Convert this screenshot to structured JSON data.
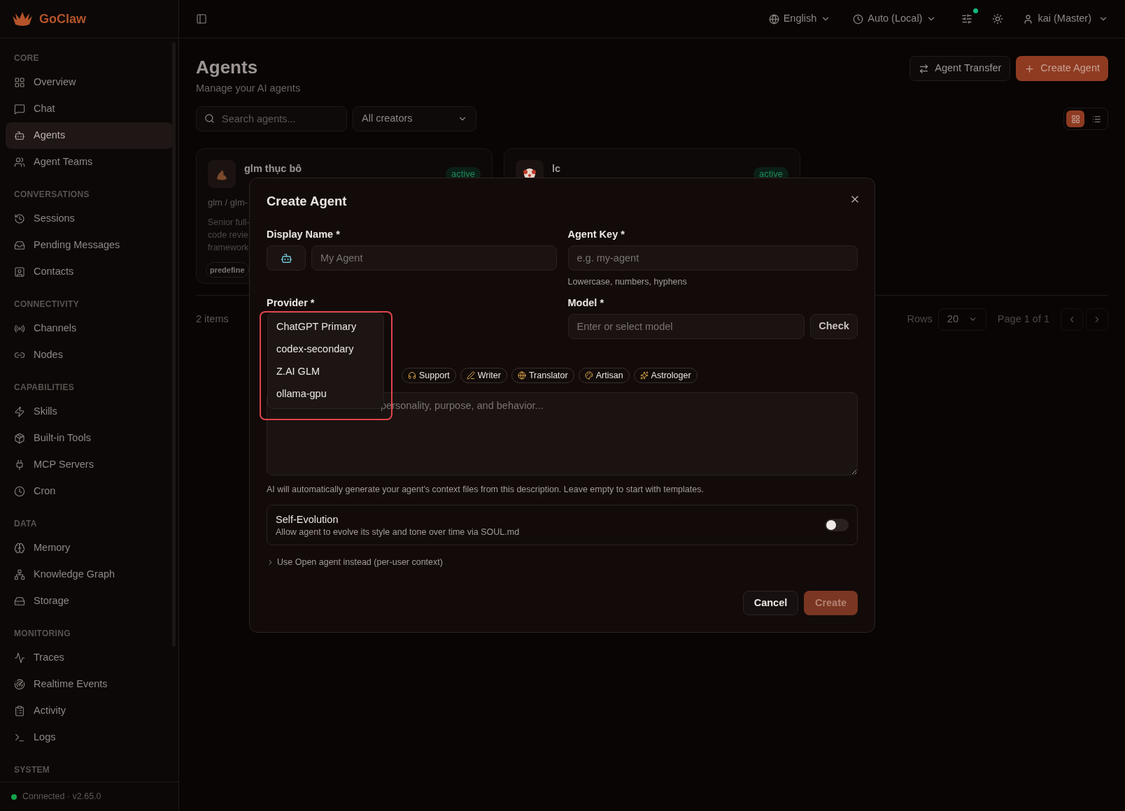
{
  "brand": {
    "name": "GoClaw"
  },
  "topbar": {
    "language": "English",
    "timezone": "Auto (Local)",
    "notification_dot": {
      "color": "#10b981"
    },
    "user": "kai (Master)"
  },
  "sidebar": {
    "sections": [
      {
        "title": "CORE",
        "items": [
          {
            "label": "Overview",
            "selected": false
          },
          {
            "label": "Chat",
            "selected": false
          },
          {
            "label": "Agents",
            "selected": true
          },
          {
            "label": "Agent Teams",
            "selected": false
          }
        ]
      },
      {
        "title": "CONVERSATIONS",
        "items": [
          {
            "label": "Sessions",
            "selected": false
          },
          {
            "label": "Pending Messages",
            "selected": false
          },
          {
            "label": "Contacts",
            "selected": false
          }
        ]
      },
      {
        "title": "CONNECTIVITY",
        "items": [
          {
            "label": "Channels",
            "selected": false
          },
          {
            "label": "Nodes",
            "selected": false
          }
        ]
      },
      {
        "title": "CAPABILITIES",
        "items": [
          {
            "label": "Skills",
            "selected": false
          },
          {
            "label": "Built-in Tools",
            "selected": false
          },
          {
            "label": "MCP Servers",
            "selected": false
          },
          {
            "label": "Cron",
            "selected": false
          }
        ]
      },
      {
        "title": "DATA",
        "items": [
          {
            "label": "Memory",
            "selected": false
          },
          {
            "label": "Knowledge Graph",
            "selected": false
          },
          {
            "label": "Storage",
            "selected": false
          }
        ]
      },
      {
        "title": "MONITORING",
        "items": [
          {
            "label": "Traces",
            "selected": false
          },
          {
            "label": "Realtime Events",
            "selected": false
          },
          {
            "label": "Activity",
            "selected": false
          },
          {
            "label": "Logs",
            "selected": false
          }
        ]
      },
      {
        "title": "SYSTEM"
      }
    ],
    "status": {
      "text": "Connected · v2.65.0",
      "color": "#16a34a"
    }
  },
  "page": {
    "title": "Agents",
    "subtitle": "Manage your AI agents",
    "actions": [
      "Agent Transfer",
      "Create Agent"
    ],
    "search": {
      "placeholder": "Search agents..."
    },
    "creator_filter": "All creators",
    "views": [
      {
        "kind": "grid",
        "selected": true
      },
      {
        "kind": "list",
        "selected": false
      }
    ],
    "cards": [
      {
        "name": "glm thục bô",
        "status": "active",
        "model": "glm / glm-",
        "description": [
          "Senior full-",
          "code revie",
          "framework"
        ],
        "tag": "predefine"
      },
      {
        "name": "lc",
        "status": "active"
      }
    ],
    "count": "2 items",
    "rows_label": "Rows",
    "rows": "20",
    "page_info": "Page 1 of 1"
  },
  "dialog": {
    "title": "Create Agent",
    "display_name": {
      "label": "Display Name *",
      "placeholder": "My Agent"
    },
    "agent_key": {
      "label": "Agent Key *",
      "placeholder": "e.g. my-agent",
      "hint": "Lowercase, numbers, hyphens"
    },
    "provider": {
      "label": "Provider *",
      "options": [
        "ChatGPT Primary",
        "codex-secondary",
        "Z.AI GLM",
        "ollama-gpu"
      ]
    },
    "model": {
      "label": "Model *",
      "placeholder": "Enter or select model",
      "button": "Check"
    },
    "templates": [
      {
        "label": "Support"
      },
      {
        "label": "Writer"
      },
      {
        "label": "Translator"
      },
      {
        "label": "Artisan"
      },
      {
        "label": "Astrologer"
      }
    ],
    "description": {
      "placeholder": "personality, purpose, and behavior...",
      "hint": "AI will automatically generate your agent's context files from this description. Leave empty to start with templates."
    },
    "self_evolution": {
      "title": "Self-Evolution",
      "text": "Allow agent to evolve its style and tone over time via SOUL.md",
      "on": false
    },
    "open_agent": {
      "label": "Use Open agent instead (per-user context)",
      "expanded": false
    },
    "cancel": "Cancel",
    "create": {
      "label": "Create",
      "disabled": true
    }
  }
}
